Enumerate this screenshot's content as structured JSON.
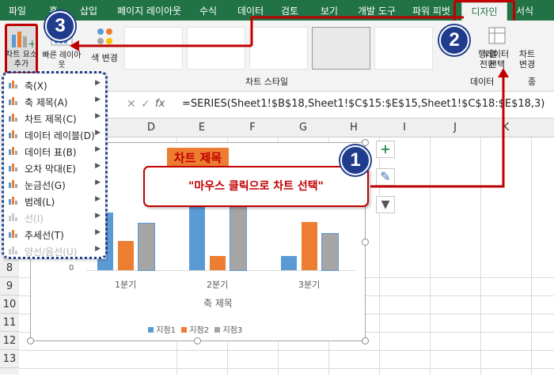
{
  "ribbon_tabs": [
    "파일",
    "홈",
    "삽입",
    "페이지 레이아웃",
    "수식",
    "데이터",
    "검토",
    "보기",
    "개발 도구",
    "파워 피벗",
    "디자인",
    "서식"
  ],
  "ribbon": {
    "add_chart_element": "차트 요소 추가",
    "quick_layout": "빠른 레이아웃",
    "change_color": "색 변경",
    "chart_styles_group": "차트 스타일",
    "switch_row_col": "행/열 전환",
    "select_data": "데이터 선택",
    "data_group": "데이터",
    "change_chart_type": "차트 변경",
    "type_group": "종"
  },
  "formula_bar": {
    "fx": "fx",
    "formula": "=SERIES(Sheet1!$B$18,Sheet1!$C$15:$E$15,Sheet1!$C$18:$E$18,3)"
  },
  "columns": [
    "D",
    "E",
    "F",
    "G",
    "H",
    "I",
    "J",
    "K"
  ],
  "rows": [
    "8",
    "9",
    "10",
    "11",
    "12",
    "13"
  ],
  "menu_items": [
    {
      "label": "축(X)",
      "disabled": false
    },
    {
      "label": "축 제목(A)",
      "disabled": false
    },
    {
      "label": "차트 제목(C)",
      "disabled": false
    },
    {
      "label": "데이터 레이블(D)",
      "disabled": false
    },
    {
      "label": "데이터 표(B)",
      "disabled": false
    },
    {
      "label": "오차 막대(E)",
      "disabled": false
    },
    {
      "label": "눈금선(G)",
      "disabled": false
    },
    {
      "label": "범례(L)",
      "disabled": false
    },
    {
      "label": "선(I)",
      "disabled": true
    },
    {
      "label": "추세선(T)",
      "disabled": false
    },
    {
      "label": "양선/음선(U)",
      "disabled": true
    }
  ],
  "chart_data": {
    "type": "bar",
    "title": "차트 제목",
    "xlabel": "축 제목",
    "categories": [
      "1분기",
      "2분기",
      "3분기"
    ],
    "y_tick_visible": "0",
    "series": [
      {
        "name": "지점1",
        "color": "#5b9bd5",
        "values": [
          60,
          90,
          15
        ]
      },
      {
        "name": "지점2",
        "color": "#ed7d31",
        "values": [
          30,
          15,
          50
        ]
      },
      {
        "name": "지점3",
        "color": "#a5a5a5",
        "values": [
          48,
          75,
          38
        ]
      }
    ]
  },
  "annotations": {
    "step1": "1",
    "step2": "2",
    "step3": "3",
    "callout": "\"마우스 클릭으로 차트 선택\""
  }
}
